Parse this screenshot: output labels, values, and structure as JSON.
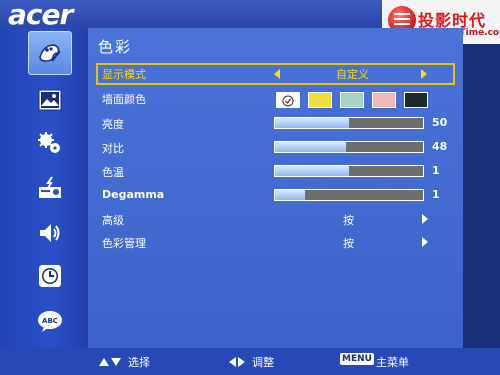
{
  "brand": {
    "logo_text": "acer"
  },
  "watermark": {
    "title": "投影时代",
    "url": "www.PjTime.com"
  },
  "sidebar": {
    "items": [
      {
        "icon": "color-palette-icon",
        "selected": true
      },
      {
        "icon": "image-icon",
        "selected": false
      },
      {
        "icon": "settings-gears-icon",
        "selected": false
      },
      {
        "icon": "projector-icon",
        "selected": false
      },
      {
        "icon": "speaker-volume-icon",
        "selected": false
      },
      {
        "icon": "clock-timer-icon",
        "selected": false
      },
      {
        "icon": "language-abc-icon",
        "selected": false
      }
    ]
  },
  "menu": {
    "title": "色彩",
    "display_mode": {
      "label": "显示模式",
      "value": "自定义"
    },
    "wall_color": {
      "label": "墙面颜色",
      "swatches": [
        "#ffffff",
        "#f2dd3f",
        "#a9d3c9",
        "#f1b8ba",
        "#1a2a28"
      ],
      "selected_index": 0
    },
    "brightness": {
      "label": "亮度",
      "value": "50",
      "level": 0.5
    },
    "contrast": {
      "label": "对比",
      "value": "48",
      "level": 0.48
    },
    "color_temp": {
      "label": "色温",
      "value": "1",
      "level": 0.5
    },
    "degamma": {
      "label": "Degamma",
      "value": "1",
      "level": 0.2
    },
    "advanced": {
      "label": "高级",
      "action": "按"
    },
    "color_mgmt": {
      "label": "色彩管理",
      "action": "按"
    }
  },
  "footer": {
    "select": "选择",
    "adjust": "调整",
    "menu_key": "MENU",
    "main_menu": "主菜单"
  }
}
